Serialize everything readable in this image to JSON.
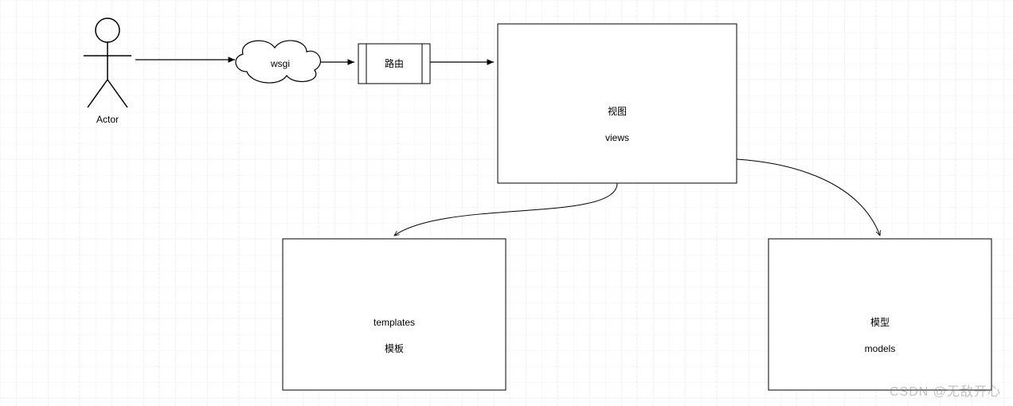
{
  "actor": {
    "label": "Actor"
  },
  "wsgi": {
    "label": "wsgi"
  },
  "router": {
    "label": "路由"
  },
  "views": {
    "line1": "视图",
    "line2": "views"
  },
  "templates": {
    "line1": "templates",
    "line2": "模板"
  },
  "models": {
    "line1": "模型",
    "line2": "models"
  },
  "watermark": "CSDN @无敌开心"
}
